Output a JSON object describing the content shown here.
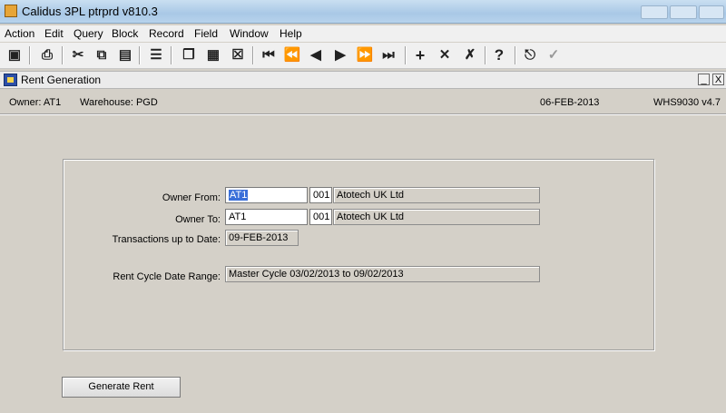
{
  "window": {
    "title": "Calidus 3PL ptrprd v810.3"
  },
  "menu": [
    "Action",
    "Edit",
    "Query",
    "Block",
    "Record",
    "Field",
    "Window",
    "Help"
  ],
  "toolbar": {
    "icons": [
      "save-icon",
      "print-icon",
      "cut-icon",
      "copy-icon",
      "paste-icon",
      "list-icon",
      "duplicate-icon",
      "insert-block-icon",
      "clear-icon",
      "first-record-icon",
      "previous-set-icon",
      "previous-record-icon",
      "next-record-icon",
      "next-set-icon",
      "last-record-icon",
      "insert-record-icon",
      "delete-record-icon",
      "clear-record-icon",
      "help-icon",
      "exit-icon",
      "accept-icon"
    ]
  },
  "form": {
    "title": "Rent Generation",
    "controls": {
      "minimize": "_",
      "close": "X"
    },
    "owner_info": "Owner:  AT1",
    "warehouse_info": "Warehouse:  PGD",
    "date": "06-FEB-2013",
    "form_id": "WHS9030  v4.7"
  },
  "fields": {
    "owner_from": {
      "label": "Owner From:",
      "value": "AT1",
      "code": "001",
      "name": "Atotech UK Ltd"
    },
    "owner_to": {
      "label": "Owner To:",
      "value": "AT1",
      "code": "001",
      "name": "Atotech UK Ltd"
    },
    "transactions_date": {
      "label": "Transactions up to Date:",
      "value": "09-FEB-2013"
    },
    "rent_cycle": {
      "label": "Rent Cycle Date Range:",
      "value": "Master Cycle 03/02/2013 to 09/02/2013"
    }
  },
  "buttons": {
    "generate": "Generate Rent"
  }
}
